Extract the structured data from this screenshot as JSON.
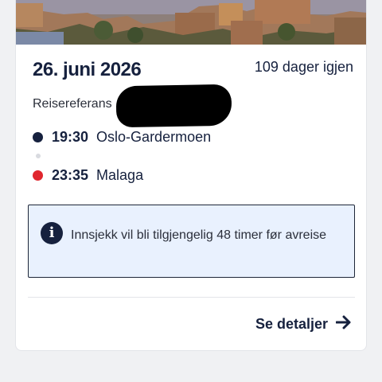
{
  "trip": {
    "date": "26. juni 2026",
    "days_left": "109 dager igjen",
    "reference_label": "Reisereferans"
  },
  "departure": {
    "time": "19:30",
    "place": "Oslo-Gardermoen",
    "color": "#16213e"
  },
  "arrival": {
    "time": "23:35",
    "place": "Malaga",
    "color": "#e0262e"
  },
  "notice": {
    "icon": "info-icon",
    "text": "Innsjekk vil bli tilgjengelig 48 timer før avreise"
  },
  "actions": {
    "details_label": "Se detaljer",
    "details_icon": "arrow-right-icon"
  }
}
